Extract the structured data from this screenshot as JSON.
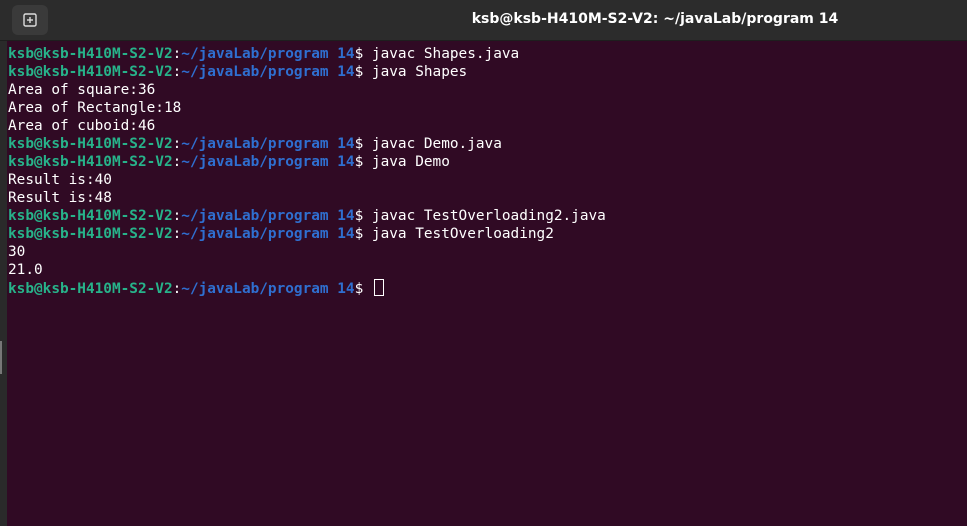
{
  "window": {
    "title": "ksb@ksb-H410M-S2-V2: ~/javaLab/program 14",
    "new_tab_icon": "new-tab-icon"
  },
  "prompt": {
    "user_host": "ksb@ksb-H410M-S2-V2",
    "separator": ":",
    "path": "~/javaLab/program 14",
    "symbol": "$"
  },
  "lines": [
    {
      "type": "prompt",
      "command": " javac Shapes.java"
    },
    {
      "type": "prompt",
      "command": " java Shapes"
    },
    {
      "type": "output",
      "text": "Area of square:36"
    },
    {
      "type": "output",
      "text": "Area of Rectangle:18"
    },
    {
      "type": "output",
      "text": "Area of cuboid:46"
    },
    {
      "type": "prompt",
      "command": " javac Demo.java"
    },
    {
      "type": "prompt",
      "command": " java Demo"
    },
    {
      "type": "output",
      "text": "Result is:40"
    },
    {
      "type": "output",
      "text": "Result is:48"
    },
    {
      "type": "prompt",
      "command": " javac TestOverloading2.java"
    },
    {
      "type": "prompt",
      "command": " java TestOverloading2"
    },
    {
      "type": "output",
      "text": "30"
    },
    {
      "type": "output",
      "text": "21.0"
    },
    {
      "type": "prompt",
      "command": " ",
      "cursor": true
    }
  ],
  "colors": {
    "background": "#300a24",
    "user_host": "#27b38a",
    "path": "#2f6fd0",
    "text": "#ffffff"
  }
}
